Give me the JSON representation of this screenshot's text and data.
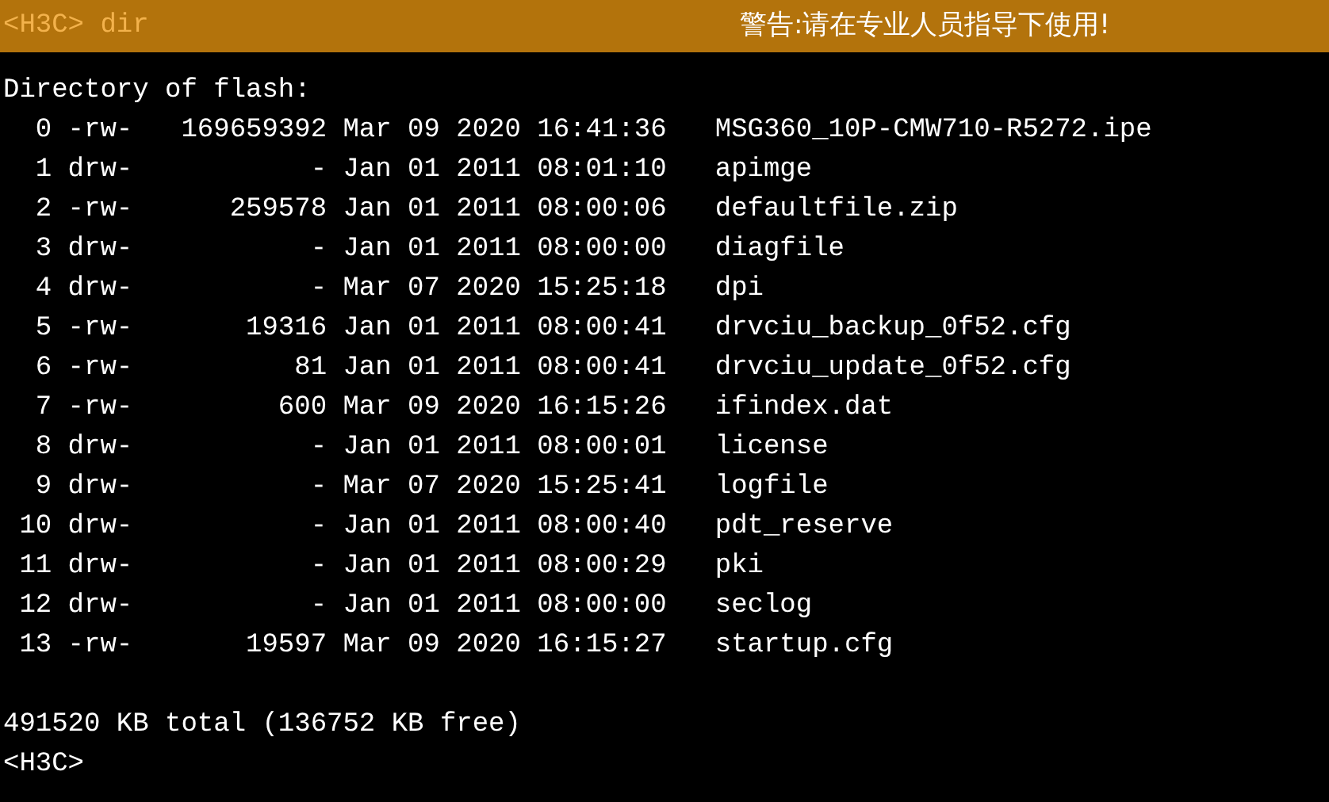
{
  "top_bar": {
    "command": "<H3C> dir",
    "warning": "警告:请在专业人员指导下使用!"
  },
  "terminal": {
    "heading": "Directory of flash:",
    "entries": [
      {
        "index": "0",
        "attributes": "-rw-",
        "size": "169659392",
        "date": "Mar 09 2020",
        "time": "16:41:36",
        "name": "MSG360_10P-CMW710-R5272.ipe"
      },
      {
        "index": "1",
        "attributes": "drw-",
        "size": "-",
        "date": "Jan 01 2011",
        "time": "08:01:10",
        "name": "apimge"
      },
      {
        "index": "2",
        "attributes": "-rw-",
        "size": "259578",
        "date": "Jan 01 2011",
        "time": "08:00:06",
        "name": "defaultfile.zip"
      },
      {
        "index": "3",
        "attributes": "drw-",
        "size": "-",
        "date": "Jan 01 2011",
        "time": "08:00:00",
        "name": "diagfile"
      },
      {
        "index": "4",
        "attributes": "drw-",
        "size": "-",
        "date": "Mar 07 2020",
        "time": "15:25:18",
        "name": "dpi"
      },
      {
        "index": "5",
        "attributes": "-rw-",
        "size": "19316",
        "date": "Jan 01 2011",
        "time": "08:00:41",
        "name": "drvciu_backup_0f52.cfg"
      },
      {
        "index": "6",
        "attributes": "-rw-",
        "size": "81",
        "date": "Jan 01 2011",
        "time": "08:00:41",
        "name": "drvciu_update_0f52.cfg"
      },
      {
        "index": "7",
        "attributes": "-rw-",
        "size": "600",
        "date": "Mar 09 2020",
        "time": "16:15:26",
        "name": "ifindex.dat"
      },
      {
        "index": "8",
        "attributes": "drw-",
        "size": "-",
        "date": "Jan 01 2011",
        "time": "08:00:01",
        "name": "license"
      },
      {
        "index": "9",
        "attributes": "drw-",
        "size": "-",
        "date": "Mar 07 2020",
        "time": "15:25:41",
        "name": "logfile"
      },
      {
        "index": "10",
        "attributes": "drw-",
        "size": "-",
        "date": "Jan 01 2011",
        "time": "08:00:40",
        "name": "pdt_reserve"
      },
      {
        "index": "11",
        "attributes": "drw-",
        "size": "-",
        "date": "Jan 01 2011",
        "time": "08:00:29",
        "name": "pki"
      },
      {
        "index": "12",
        "attributes": "drw-",
        "size": "-",
        "date": "Jan 01 2011",
        "time": "08:00:00",
        "name": "seclog"
      },
      {
        "index": "13",
        "attributes": "-rw-",
        "size": "19597",
        "date": "Mar 09 2020",
        "time": "16:15:27",
        "name": "startup.cfg"
      }
    ],
    "summary": "491520 KB total (136752 KB free)",
    "prompt": "<H3C>"
  }
}
